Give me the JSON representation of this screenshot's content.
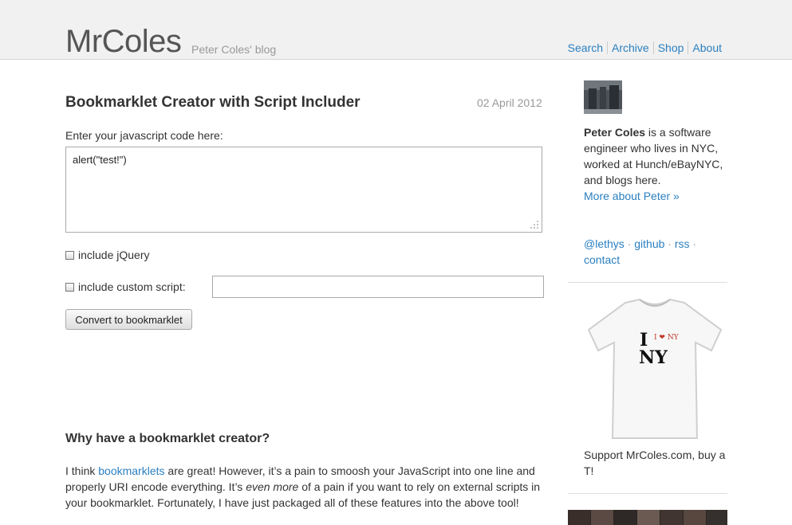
{
  "header": {
    "site_title": "MrColes",
    "site_subtitle": "Peter Coles' blog",
    "nav": [
      "Search",
      "Archive",
      "Shop",
      "About"
    ]
  },
  "post": {
    "title": "Bookmarklet Creator with Script Includer",
    "date": "02 April 2012",
    "code_label": "Enter your javascript code here:",
    "code_value": "alert(\"test!\")",
    "jquery_label": "include jQuery",
    "custom_label": "include custom script:",
    "custom_value": "",
    "convert_button": "Convert to bookmarklet",
    "why_heading": "Why have a bookmarklet creator?",
    "para": {
      "part1": "I think ",
      "link": "bookmarklets",
      "part2": " are great! However, it’s a pain to smoosh your JavaScript into one line and properly URI encode everything. It’s ",
      "emph": "even more",
      "part3": " of a pain if you want to rely on external scripts in your bookmarklet. Fortunately, I have just packaged all of these features into the above tool!"
    }
  },
  "sidebar": {
    "bio_name": "Peter Coles",
    "bio_text": " is a software engineer who lives in NYC, worked at Hunch/eBayNYC, and blogs here.",
    "more_link": "More about Peter »",
    "links": [
      "@lethys",
      "github",
      "rss",
      "contact"
    ],
    "link_sep": " · ",
    "tshirt_line1": "I",
    "tshirt_heart": "I ❤ NY",
    "tshirt_line2": "NY",
    "support_text": "Support MrColes.com, buy a T!"
  },
  "colors": {
    "link": "#2a7fc0",
    "header_bg": "#f1f1f1"
  }
}
